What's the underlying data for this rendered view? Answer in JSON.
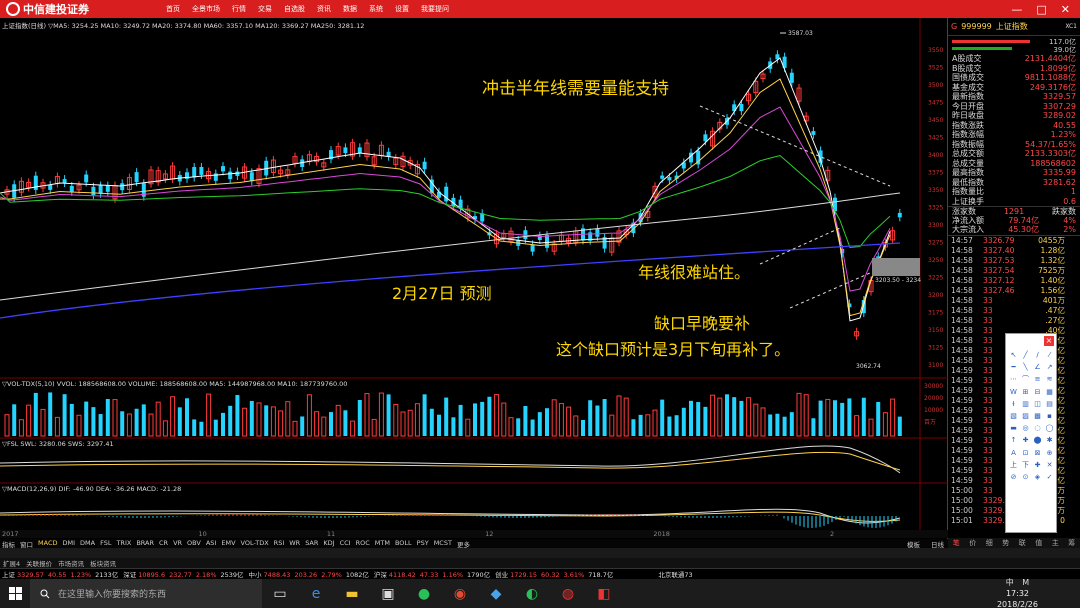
{
  "app": {
    "logo_text": "中信建投证券",
    "menu": [
      "首页",
      "全景市场",
      "行情",
      "交易",
      "自选股",
      "资讯",
      "数据",
      "系统",
      "设置",
      "我要提问"
    ],
    "window_buttons": [
      "—",
      "□",
      "✕"
    ]
  },
  "chart": {
    "header_line": "上证指数(日线) ▽MA5: 3254.25  MA10: 3249.72  MA20: 3374.80  MA60: 3357.10  MA120: 3369.27  MA250: 3281.12",
    "price_ticks": [
      "3550",
      "3525",
      "3500",
      "3475",
      "3450",
      "3425",
      "3400",
      "3375",
      "3350",
      "3325",
      "3300",
      "3275",
      "3250",
      "3225",
      "3200",
      "3175",
      "3150",
      "3125",
      "3100"
    ],
    "high_label": "3587.03",
    "low_label": "3062.74",
    "gap_label": "3203.50 - 3234",
    "volume_header": "▽VOL-TDX(5,10)  VVOL: 188568608.00  VOLUME: 188568608.00  MA5: 144987968.00  MA10: 187739760.00",
    "volume_ticks": [
      "30000",
      "20000",
      "10000",
      "百万"
    ],
    "fsl_header": "▽FSL  SWL: 3280.06  SWS: 3297.41",
    "macd_header": "▽MACD(12,26,9)  DIF: -46.90  DEA: -36.26  MACD: -21.28",
    "time_labels": [
      "2017",
      "10",
      "11",
      "12",
      "2018",
      "2"
    ],
    "indicator_tabs": [
      "指标",
      "窗口",
      "MACD",
      "DMI",
      "DMA",
      "FSL",
      "TRIX",
      "BRAR",
      "CR",
      "VR",
      "OBV",
      "ASI",
      "EMV",
      "VOL-TDX",
      "RSI",
      "WR",
      "SAR",
      "KDJ",
      "CCI",
      "ROC",
      "MTM",
      "BOLL",
      "PSY",
      "MCST",
      "更多"
    ],
    "right_tabs": [
      "模板",
      "日线"
    ]
  },
  "annotations": {
    "a1": "冲击半年线需要量能支持",
    "a2": "年线很难站住。",
    "a3": "2月27日 预测",
    "a4": "缺口早晚要补",
    "a5": "这个缺口预计是3月下旬再补了。"
  },
  "quote": {
    "code": "999999",
    "name": "上证指数",
    "tag": "XC1",
    "top_vals": [
      "117.0亿",
      "39.0亿"
    ],
    "rows": [
      {
        "label": "A股成交",
        "value": "2131.4404亿"
      },
      {
        "label": "B股成交",
        "value": "1.8099亿"
      },
      {
        "label": "国债成交",
        "value": "9811.1088亿"
      },
      {
        "label": "基金成交",
        "value": "249.3176亿"
      },
      {
        "label": "最新指数",
        "value": "3329.57"
      },
      {
        "label": "今日开盘",
        "value": "3307.29"
      },
      {
        "label": "昨日收盘",
        "value": "3289.02"
      },
      {
        "label": "指数涨跌",
        "value": "40.55"
      },
      {
        "label": "指数涨幅",
        "value": "1.23%"
      },
      {
        "label": "指数振幅",
        "value": "54.37/1.65%"
      },
      {
        "label": "总成交额",
        "value": "2133.3303亿"
      },
      {
        "label": "总成交量",
        "value": "188568602"
      },
      {
        "label": "最高指数",
        "value": "3335.99"
      },
      {
        "label": "最低指数",
        "value": "3281.62"
      },
      {
        "label": "指数量比",
        "value": "1"
      },
      {
        "label": "上证换手",
        "value": "0.6"
      }
    ],
    "updown": {
      "up_label": "涨家数",
      "up_value": "1291",
      "down_label": "跌家数"
    },
    "flows": [
      {
        "label": "净流入额",
        "value": "79.74亿",
        "pct": "4%"
      },
      {
        "label": "大宗流入",
        "value": "45.30亿",
        "pct": "2%"
      }
    ],
    "ticks": [
      {
        "t": "14:57",
        "p": "3326.79",
        "v": "0455万"
      },
      {
        "t": "14:58",
        "p": "3327.40",
        "v": "1.28亿"
      },
      {
        "t": "14:58",
        "p": "3327.53",
        "v": "1.32亿"
      },
      {
        "t": "14:58",
        "p": "3327.54",
        "v": "7525万"
      },
      {
        "t": "14:58",
        "p": "3327.12",
        "v": "1.40亿"
      },
      {
        "t": "14:58",
        "p": "3327.46",
        "v": "1.56亿"
      },
      {
        "t": "14:58",
        "p": "33",
        "v": "401万"
      },
      {
        "t": "14:58",
        "p": "33",
        "v": ".47亿"
      },
      {
        "t": "14:58",
        "p": "33",
        "v": ".27亿"
      },
      {
        "t": "14:58",
        "p": "33",
        "v": ".40亿"
      },
      {
        "t": "14:58",
        "p": "33",
        "v": ".43亿"
      },
      {
        "t": "14:58",
        "p": "33",
        "v": ".57亿"
      },
      {
        "t": "14:58",
        "p": "33",
        "v": ".02亿"
      },
      {
        "t": "14:59",
        "p": "33",
        "v": ".45亿"
      },
      {
        "t": "14:59",
        "p": "33",
        "v": ".63亿"
      },
      {
        "t": "14:59",
        "p": "33",
        "v": ".01亿"
      },
      {
        "t": "14:59",
        "p": "33",
        "v": ".63亿"
      },
      {
        "t": "14:59",
        "p": "33",
        "v": ".98亿"
      },
      {
        "t": "14:59",
        "p": "33",
        "v": ".21亿"
      },
      {
        "t": "14:59",
        "p": "33",
        "v": ".69亿"
      },
      {
        "t": "14:59",
        "p": "33",
        "v": ".79亿"
      },
      {
        "t": "14:59",
        "p": "33",
        "v": ".06亿"
      },
      {
        "t": "14:59",
        "p": "33",
        "v": ".74亿"
      },
      {
        "t": "14:59",
        "p": "33",
        "v": ".58亿"
      },
      {
        "t": "14:59",
        "p": "33",
        "v": ".94亿"
      },
      {
        "t": "15:00",
        "p": "33",
        "v": "572万"
      },
      {
        "t": "15:00",
        "p": "3329.50",
        "v": "248万"
      },
      {
        "t": "15:00",
        "p": "3329.50",
        "v": "316万"
      },
      {
        "t": "15:01",
        "p": "3329.57",
        "v": "0"
      }
    ],
    "bottom_tabs": [
      "笔",
      "价",
      "细",
      "势",
      "联",
      "值",
      "主",
      "筹"
    ]
  },
  "bottom": {
    "bar1": [
      "扩展4",
      "关联报价",
      "市场资讯",
      "板块资讯"
    ],
    "status": [
      {
        "name": "上证",
        "val": "3329.57",
        "chg": "40.55",
        "pct": "1.23%",
        "amt": "2133亿"
      },
      {
        "name": "深证",
        "val": "10895.6",
        "chg": "232.77",
        "pct": "2.18%",
        "amt": "2539亿"
      },
      {
        "name": "中小",
        "val": "7488.43",
        "chg": "203.26",
        "pct": "2.79%",
        "amt": "1082亿"
      },
      {
        "name": "沪深",
        "val": "4118.42",
        "chg": "47.33",
        "pct": "1.16%",
        "amt": "1790亿"
      },
      {
        "name": "创业",
        "val": "1729.15",
        "chg": "60.32",
        "pct": "3.61%",
        "amt": "718.7亿"
      }
    ],
    "server": "北京联通73"
  },
  "taskbar": {
    "search_placeholder": "在这里输入你要搜索的东西",
    "time": "17:32",
    "date": "2018/2/26",
    "ime": "中",
    "ime2": "M"
  }
}
